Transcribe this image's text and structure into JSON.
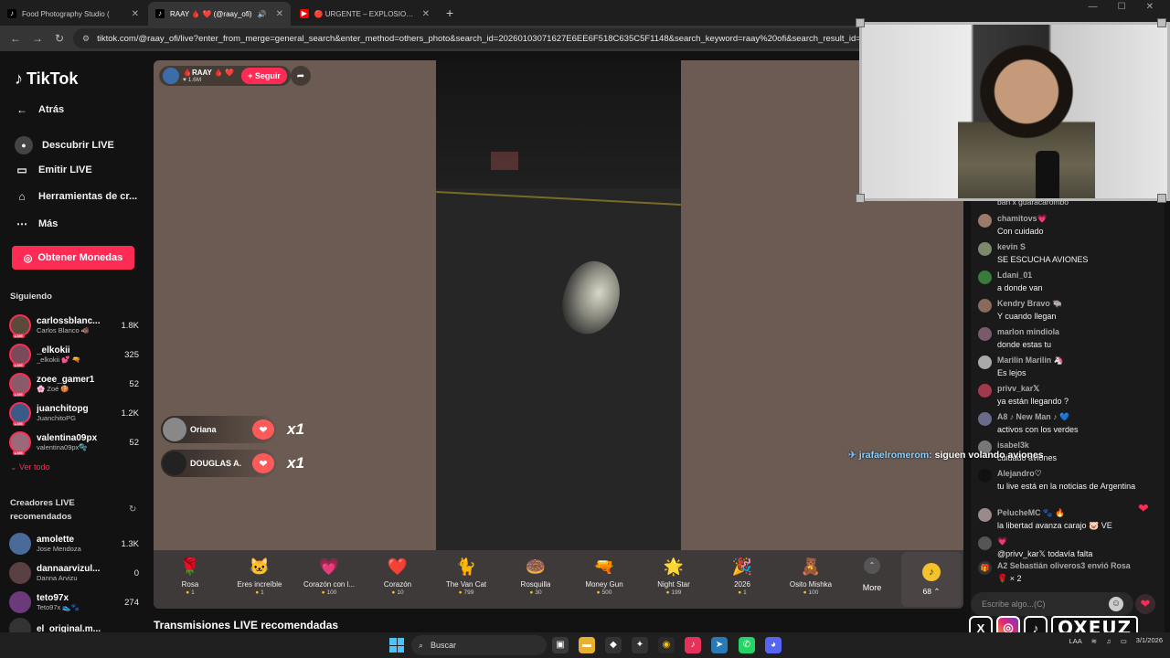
{
  "browser": {
    "tabs": [
      {
        "title": "Food Photography Studio (",
        "active": false
      },
      {
        "title": "RAAY 🩸 ❤️ (@raay_ofi)",
        "active": true
      },
      {
        "title": "🔴 URGENTE – EXPLOSIONES",
        "active": false
      }
    ],
    "url": "tiktok.com/@raay_ofi/live?enter_from_merge=general_search&enter_method=others_photo&search_id=20260103071627E6EE6F518C635C5F1148&search_keyword=raay%20ofi&search_result_id=721843"
  },
  "sidebar": {
    "logo": "TikTok",
    "back": "Atrás",
    "nav": [
      "Descubrir LIVE",
      "Emitir LIVE",
      "Herramientas de cr...",
      "Más"
    ],
    "coins_button": "Obtener Monedas",
    "following_title": "Siguiendo",
    "following": [
      {
        "name": "carlossblanc...",
        "sub": "Carlos Blanco 🐗",
        "count": "1.8K"
      },
      {
        "name": "_elkokii",
        "sub": "_elkokii 💕 🔫",
        "count": "325"
      },
      {
        "name": "zoee_gamer1",
        "sub": "🌸 Zoé 🍪",
        "count": "52"
      },
      {
        "name": "juanchitopg",
        "sub": "JuanchitoPG",
        "count": "1.2K"
      },
      {
        "name": "valentina09px",
        "sub": "valentina09px🫧",
        "count": "52"
      }
    ],
    "see_all": "Ver todo",
    "recommended_title": "Creadores LIVE recomendados",
    "recommended": [
      {
        "name": "amolette",
        "sub": "Jose Mendoza",
        "count": "1.3K"
      },
      {
        "name": "dannaarvizul...",
        "sub": "Danna Arvizu",
        "count": "0"
      },
      {
        "name": "teto97x",
        "sub": "Teto97x 👟🐾",
        "count": "274"
      },
      {
        "name": "el_original.m...",
        "sub": "",
        "count": ""
      }
    ]
  },
  "stream": {
    "host_name": "🩸RAAY 🩸 ❤️",
    "host_likes": "1.6M",
    "follow_label": "+ Seguir",
    "gift_events": [
      {
        "user": "Oriana",
        "count": "x1"
      },
      {
        "user": "DOUGLAS A. ...",
        "count": "x1"
      }
    ],
    "recommended_title": "Transmisiones LIVE recomendadas"
  },
  "gifts": [
    {
      "name": "Rosa",
      "price": "1",
      "icon": "🌹"
    },
    {
      "name": "Eres increíble",
      "price": "1",
      "icon": "🐱"
    },
    {
      "name": "Corazón con l...",
      "price": "100",
      "icon": "💗"
    },
    {
      "name": "Corazón",
      "price": "10",
      "icon": "❤️"
    },
    {
      "name": "The Van Cat",
      "price": "799",
      "icon": "🐈"
    },
    {
      "name": "Rosquilla",
      "price": "30",
      "icon": "🍩"
    },
    {
      "name": "Money Gun",
      "price": "500",
      "icon": "🔫"
    },
    {
      "name": "Night Star",
      "price": "199",
      "icon": "🌟"
    },
    {
      "name": "2026",
      "price": "1",
      "icon": "🎉"
    },
    {
      "name": "Osito Mishka",
      "price": "100",
      "icon": "🧸"
    }
  ],
  "more_label": "More",
  "coin_balance": "68",
  "chat": {
    "first_line": "ban x guaracarombo",
    "messages": [
      {
        "user": "chamitovs💗",
        "text": "Con cuidado"
      },
      {
        "user": "kevin S",
        "text": "SE ESCUCHA AVIONES"
      },
      {
        "user": "Ldani_01",
        "text": "a donde van"
      },
      {
        "user": "Kendry Bravo 🐃",
        "text": "Y cuando llegan"
      },
      {
        "user": "marlon mindiola",
        "text": "donde estas tu"
      },
      {
        "user": "Marilin Marilin 🦄",
        "text": "Es lejos"
      },
      {
        "user": "privv_kar𝕏",
        "text": "ya están llegando ?"
      },
      {
        "user": "A8 ♪ New Man ♪ 💙",
        "text": "activos con los verdes"
      },
      {
        "user": "isabel3k",
        "text": "cuidado aviones"
      },
      {
        "user": "Alejandro♡",
        "text": "tu live está en la noticias de Argentina"
      },
      {
        "user": "PelucheMC 🐾 🔥",
        "text": "la libertad avanza carajo 🐷 VE"
      },
      {
        "user": "💗",
        "text": "@privv_kar𝕏 todavía falta"
      },
      {
        "user": "A2 Sebastián oliveros3 envió Rosa",
        "text": "🌹 × 2"
      }
    ],
    "input_placeholder": "Escribe algo...(C)"
  },
  "overlay": {
    "user": "jrafaelromerom:",
    "text": "siguen volando aviones"
  },
  "brand": {
    "text": "OXEUZ"
  },
  "taskbar": {
    "search_label": "Buscar",
    "lang": "LAA",
    "date": "3/1/2026"
  }
}
